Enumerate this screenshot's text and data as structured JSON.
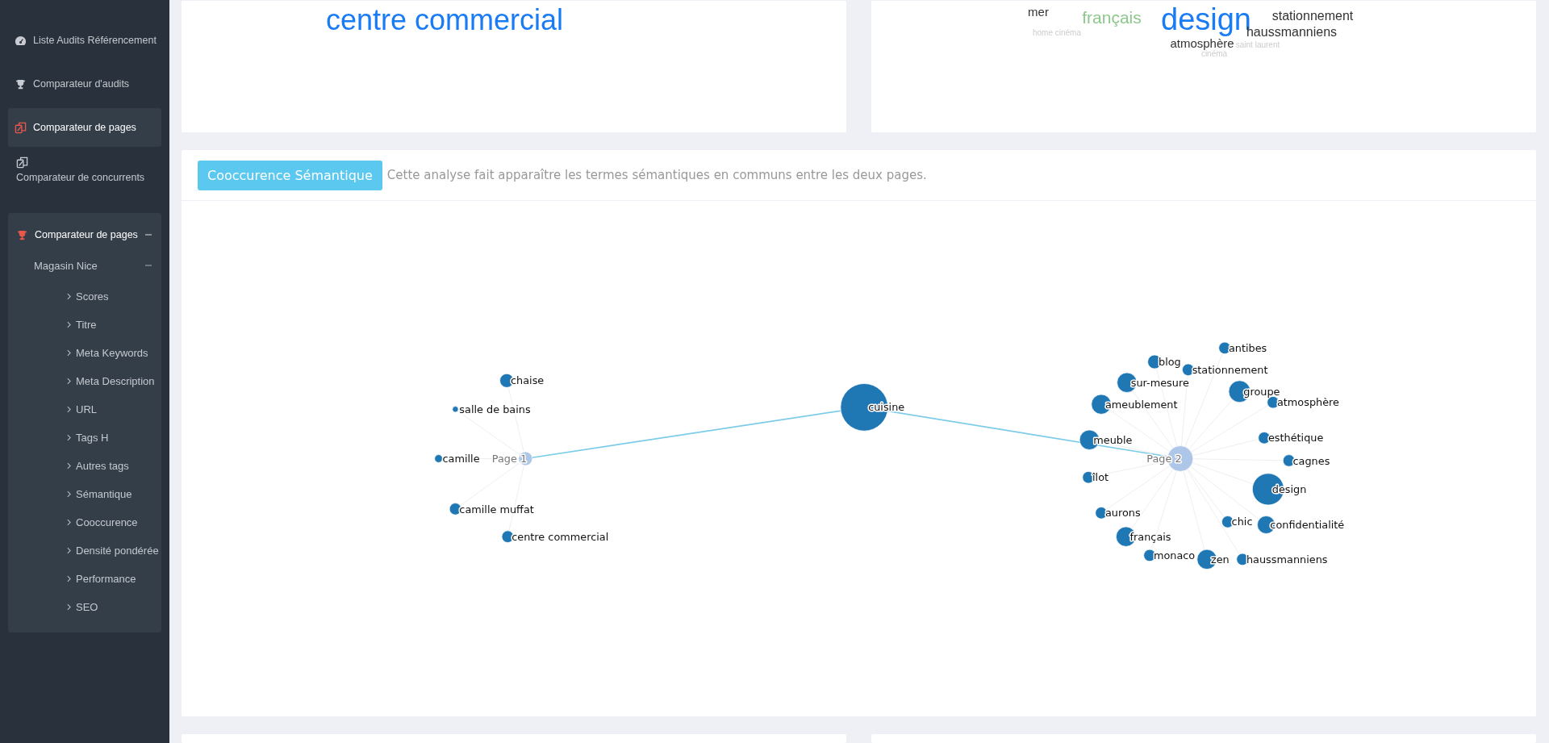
{
  "sidebar": {
    "items": [
      {
        "label": "Liste Audits Référencement",
        "selected": false
      },
      {
        "label": "Comparateur d'audits",
        "selected": false
      },
      {
        "label": "Comparateur de pages",
        "selected": true
      },
      {
        "label": "Comparateur de concurrents",
        "selected": false
      }
    ],
    "section": {
      "label": "Comparateur de pages",
      "expanded": true,
      "site": {
        "label": "Magasin Nice",
        "expanded": true,
        "children": [
          "Scores",
          "Titre",
          "Meta Keywords",
          "Meta Description",
          "URL",
          "Tags H",
          "Autres tags",
          "Sémantique",
          "Cooccurence",
          "Densité pondérée",
          "Performance",
          "SEO"
        ]
      }
    }
  },
  "clouds": [
    {
      "words": [
        {
          "text": "centre commercial",
          "color": "#1a7cf5"
        }
      ]
    },
    {
      "words": [
        {
          "text": "mer",
          "color": "#333333"
        },
        {
          "text": "français",
          "color": "#8cc78c"
        },
        {
          "text": "design",
          "color": "#1a7cf5"
        },
        {
          "text": "stationnement",
          "color": "#333333"
        },
        {
          "text": "home cinéma",
          "color": "#cccccc"
        },
        {
          "text": "haussmanniens",
          "color": "#333333"
        },
        {
          "text": "atmosphère",
          "color": "#333333"
        },
        {
          "text": "saint laurent",
          "color": "#cccccc"
        },
        {
          "text": "cinéma",
          "color": "#cccccc"
        }
      ]
    }
  ],
  "cooccurrence": {
    "button": "Cooccurence Sémantique",
    "description": "Cette analyse fait apparaître les termes sémantiques en communs entre les deux pages.",
    "graph": {
      "common": "cuisine",
      "pages": [
        {
          "label": "Page 1",
          "terms": [
            "chaise",
            "salle de bains",
            "camille",
            "camille muffat",
            "centre commercial"
          ]
        },
        {
          "label": "Page 2",
          "terms": [
            "blog",
            "antibes",
            "stationnement",
            "sur-mesure",
            "ameublement",
            "groupe",
            "atmosphère",
            "meuble",
            "esthétique",
            "cagnes",
            "îlot",
            "design",
            "aurons",
            "chic",
            "confidentialité",
            "français",
            "monaco",
            "zen",
            "haussmanniens"
          ]
        }
      ]
    }
  }
}
